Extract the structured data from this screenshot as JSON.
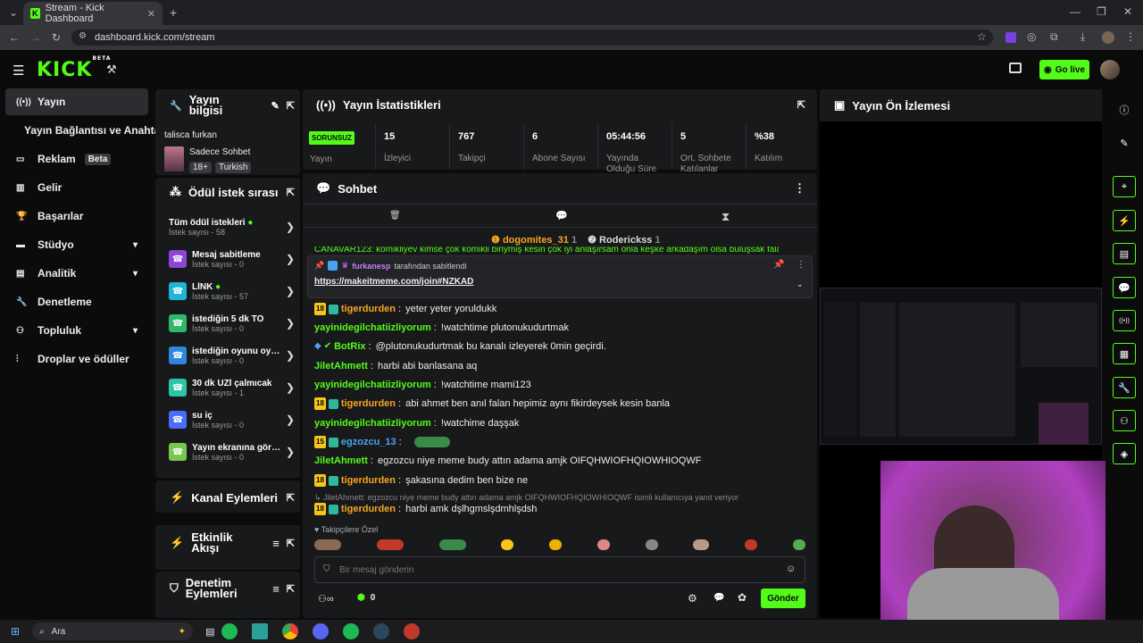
{
  "browser": {
    "tab_title": "Stream - Kick Dashboard",
    "url": "dashboard.kick.com/stream"
  },
  "header": {
    "logo": "KICK",
    "logo_sup": "BETA",
    "go_live": "Go live"
  },
  "nav": [
    {
      "label": "Yayın",
      "icon": "broadcast-icon"
    },
    {
      "label": "Yayın Bağlantısı ve Anahtarı",
      "icon": ""
    },
    {
      "label": "Reklam",
      "icon": "ad-icon",
      "badge": "Beta"
    },
    {
      "label": "Gelir",
      "icon": "chart-icon"
    },
    {
      "label": "Başarılar",
      "icon": "trophy-icon"
    },
    {
      "label": "Stüdyo",
      "icon": "studio-icon",
      "chevron": true
    },
    {
      "label": "Analitik",
      "icon": "analytics-icon",
      "chevron": true
    },
    {
      "label": "Denetleme",
      "icon": "wrench-icon"
    },
    {
      "label": "Topluluk",
      "icon": "community-icon",
      "chevron": true
    },
    {
      "label": "Droplar ve ödüller",
      "icon": "drops-icon"
    }
  ],
  "stream_info": {
    "title": "Yayın bilgisi",
    "stream_title": "talisca furkan",
    "category": "Sadece Sohbet",
    "tags": [
      "18+",
      "Turkish"
    ]
  },
  "rewards": {
    "title": "Ödül istek sırası",
    "all": {
      "title": "Tüm ödül istekleri",
      "count": "İstek sayısı - 58"
    },
    "items": [
      {
        "title": "Mesaj sabitleme",
        "count": "İstek sayısı - 0",
        "color": "#8e44d6"
      },
      {
        "title": "LİNK",
        "count": "İstek sayısı - 57",
        "color": "#1fb6d6"
      },
      {
        "title": "istediğin 5 dk TO",
        "count": "İstek sayısı - 0",
        "color": "#2fb86a"
      },
      {
        "title": "istediğin oyunu oyna...",
        "count": "İstek sayısı - 0",
        "color": "#2e86de"
      },
      {
        "title": "30 dk UZİ çalmıcak",
        "count": "İstek sayısı - 1",
        "color": "#2ec4a6"
      },
      {
        "title": "su iç",
        "count": "İstek sayısı - 0",
        "color": "#4a6cf7"
      },
      {
        "title": "Yayın ekranına görs...",
        "count": "İstek sayısı - 0",
        "color": "#7ac74f"
      }
    ]
  },
  "panels": {
    "channel_actions": "Kanal Eylemleri",
    "event_flow": "Etkinlik Akışı",
    "mod_actions": "Denetim Eylemleri"
  },
  "stats": {
    "title": "Yayın İstatistikleri",
    "status": "SORUNSUZ",
    "status_label": "Yayın",
    "items": [
      {
        "value": "15",
        "label": "İzleyici"
      },
      {
        "value": "767",
        "label": "Takipçi"
      },
      {
        "value": "6",
        "label": "Abone Sayısı"
      },
      {
        "value": "05:44:56",
        "label": "Yayında Olduğu Süre"
      },
      {
        "value": "5",
        "label": "Ort. Sohbete Katılanlar"
      },
      {
        "value": "%38",
        "label": "Katılım"
      }
    ]
  },
  "chat": {
    "title": "Sohbet",
    "leaders": [
      {
        "name": "dogomites_31",
        "count": "1"
      },
      {
        "name": "Roderickss",
        "count": "1"
      }
    ],
    "truncated_line": "CANAVAR123: komikliyev kimse çok komikli biriymiş kesin çok iyi anlaşırsam onla keşke arkadaşım olsa buluşsak falan",
    "pinned": {
      "by_user": "furkanesp",
      "by_text": "tarafından sabitlendi",
      "link": "https://makeitmeme.com/join#NZKAD"
    },
    "messages": [
      {
        "badge": "18",
        "user": "tigerdurden",
        "color": "#f5a623",
        "text": "yeter yeter yoruldukk"
      },
      {
        "user": "yayinidegilchatiizliyorum",
        "color": "#53fc18",
        "text": "!watchtime plutonukudurtmak"
      },
      {
        "bot": true,
        "user": "BotRix",
        "color": "#53fc18",
        "text": "@plutonukudurtmak bu kanalı izleyerek 0min geçirdi."
      },
      {
        "user": "JiletAhmett",
        "color": "#53fc18",
        "text": "harbi abi banlasana aq"
      },
      {
        "user": "yayinidegilchatiizliyorum",
        "color": "#53fc18",
        "text": "!watchtime mami123"
      },
      {
        "badge": "18",
        "user": "tigerdurden",
        "color": "#f5a623",
        "text": "abi ahmet ben anıl falan hepimiz aynı fikirdeysek kesin banla"
      },
      {
        "user": "yayinidegilchatiizliyorum",
        "color": "#53fc18",
        "text": "!watchime daşşak"
      },
      {
        "badge": "15",
        "user": "egzozcu_13",
        "color": "#4aa3f0",
        "text": ""
      },
      {
        "user": "JiletAhmett",
        "color": "#53fc18",
        "text": "egzozcu niye meme budy attın adama amjk OIFQHWIOFHQIOWHIOQWF"
      },
      {
        "badge": "18",
        "user": "tigerdurden",
        "color": "#f5a623",
        "text": "şakasına dedim ben bize ne"
      },
      {
        "badge": "18",
        "user": "tigerdurden",
        "color": "#f5a623",
        "text": "harbi amk dşlhgmslşdmhlşdsh"
      }
    ],
    "reply_note": "JiletAhmett: egzozcu niye meme budy attın adama amjk OIFQHWIOFHQIOWHIOQWF isimli kullanıcıya yanıt veriyor",
    "emote_section": "Takipçilere Özel",
    "placeholder": "Bir mesaj gönderin",
    "points": "0",
    "send": "Gönder"
  },
  "preview": {
    "title": "Yayın Ön İzlemesi"
  },
  "taskbar": {
    "search": "Ara"
  }
}
